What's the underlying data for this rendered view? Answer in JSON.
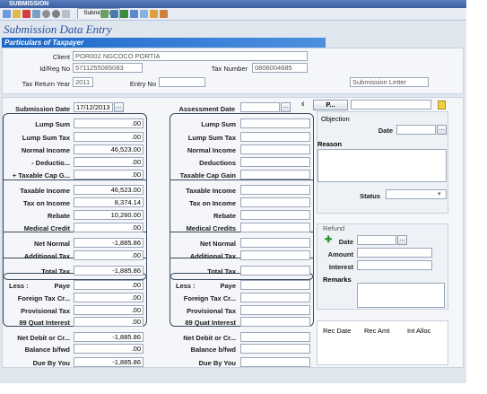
{
  "window": {
    "title": "SUBMISSION",
    "tab_label": "Submission"
  },
  "page_title": "Submission Data Entry",
  "section_title": "Particulars of Taxpayer",
  "taxpayer": {
    "client_label": "Client",
    "client_value": "POR002 NGCOCO   PORTIA",
    "idreg_label": "Id/Reg No",
    "idreg_value": "5711255085083",
    "taxnumber_label": "Tax Number",
    "taxnumber_value": "0806004685",
    "taxyear_label": "Tax Return Year",
    "taxyear_value": "2011",
    "entryno_label": "Entry No",
    "entryno_value": "",
    "submission_letter": "Submission Letter"
  },
  "left": {
    "submission_date_label": "Submission Date",
    "submission_date_value": "17/12/2013",
    "rows": [
      {
        "label": "Lump Sum",
        "value": ".00"
      },
      {
        "label": "Lump Sum Tax",
        "value": ".00"
      },
      {
        "label": "Normal Income",
        "value": "46,523.00"
      },
      {
        "label": "- Deductio...",
        "value": ".00"
      },
      {
        "label": "+ Taxable Cap G...",
        "value": ".00"
      },
      {
        "label": "Taxable Income",
        "value": "46,523.00"
      },
      {
        "label": "Tax on Income",
        "value": "8,374.14"
      },
      {
        "label": "Rebate",
        "value": "10,260.00"
      },
      {
        "label": "Medical Credit",
        "value": ".00"
      },
      {
        "label": "Net Normal",
        "value": "-1,885.86"
      },
      {
        "label": "Additional Tax",
        "value": ".00"
      },
      {
        "label": "Total Tax",
        "value": "-1,885.86"
      },
      {
        "label": "Less :",
        "label2": "Paye",
        "value": ".00"
      },
      {
        "label": "Foreign Tax Cr...",
        "value": ".00"
      },
      {
        "label": "Provisional Tax",
        "value": ".00"
      },
      {
        "label": "89 Quat Interest",
        "value": ".00"
      },
      {
        "label": "Net Debit or Cr...",
        "value": "-1,885.86"
      },
      {
        "label": "Balance b/fwd",
        "value": ".00"
      },
      {
        "label": "Due By You",
        "value": "-1,885.86"
      }
    ]
  },
  "middle": {
    "assessment_date_label": "Assessment Date",
    "rows": [
      {
        "label": "Lump Sum"
      },
      {
        "label": "Lump Sum Tax"
      },
      {
        "label": "Normal Income"
      },
      {
        "label": "Deductions"
      },
      {
        "label": "Taxable Cap Gain"
      },
      {
        "label": "Taxable Income"
      },
      {
        "label": "Tax on Income"
      },
      {
        "label": "Rebate"
      },
      {
        "label": "Medical Credits"
      },
      {
        "label": "Net Normal"
      },
      {
        "label": "Additional Tax"
      },
      {
        "label": "Total Tax"
      },
      {
        "label": "Less :",
        "label2": "Paye"
      },
      {
        "label": "Foreign Tax Cr..."
      },
      {
        "label": "Provisional Tax"
      },
      {
        "label": "89 Quat Interest"
      },
      {
        "label": "Net Debit or Cr..."
      },
      {
        "label": "Balance b/fwd"
      },
      {
        "label": "Due By You"
      }
    ]
  },
  "right": {
    "p_button": "P...",
    "objection_label": "Objection",
    "date_label": "Date",
    "reason_label": "Reason",
    "status_label": "Status",
    "refund_label": "Refund",
    "refund_date_label": "Date",
    "amount_label": "Amount",
    "interest_label": "Interest",
    "remarks_label": "Remarks",
    "table_headers": [
      "Rec Date",
      "Rec Amt",
      "Int Alloc"
    ]
  },
  "colors": {
    "accent": "#1a66c8",
    "title": "#2a4fa0",
    "panel": "#dfe6ee"
  }
}
